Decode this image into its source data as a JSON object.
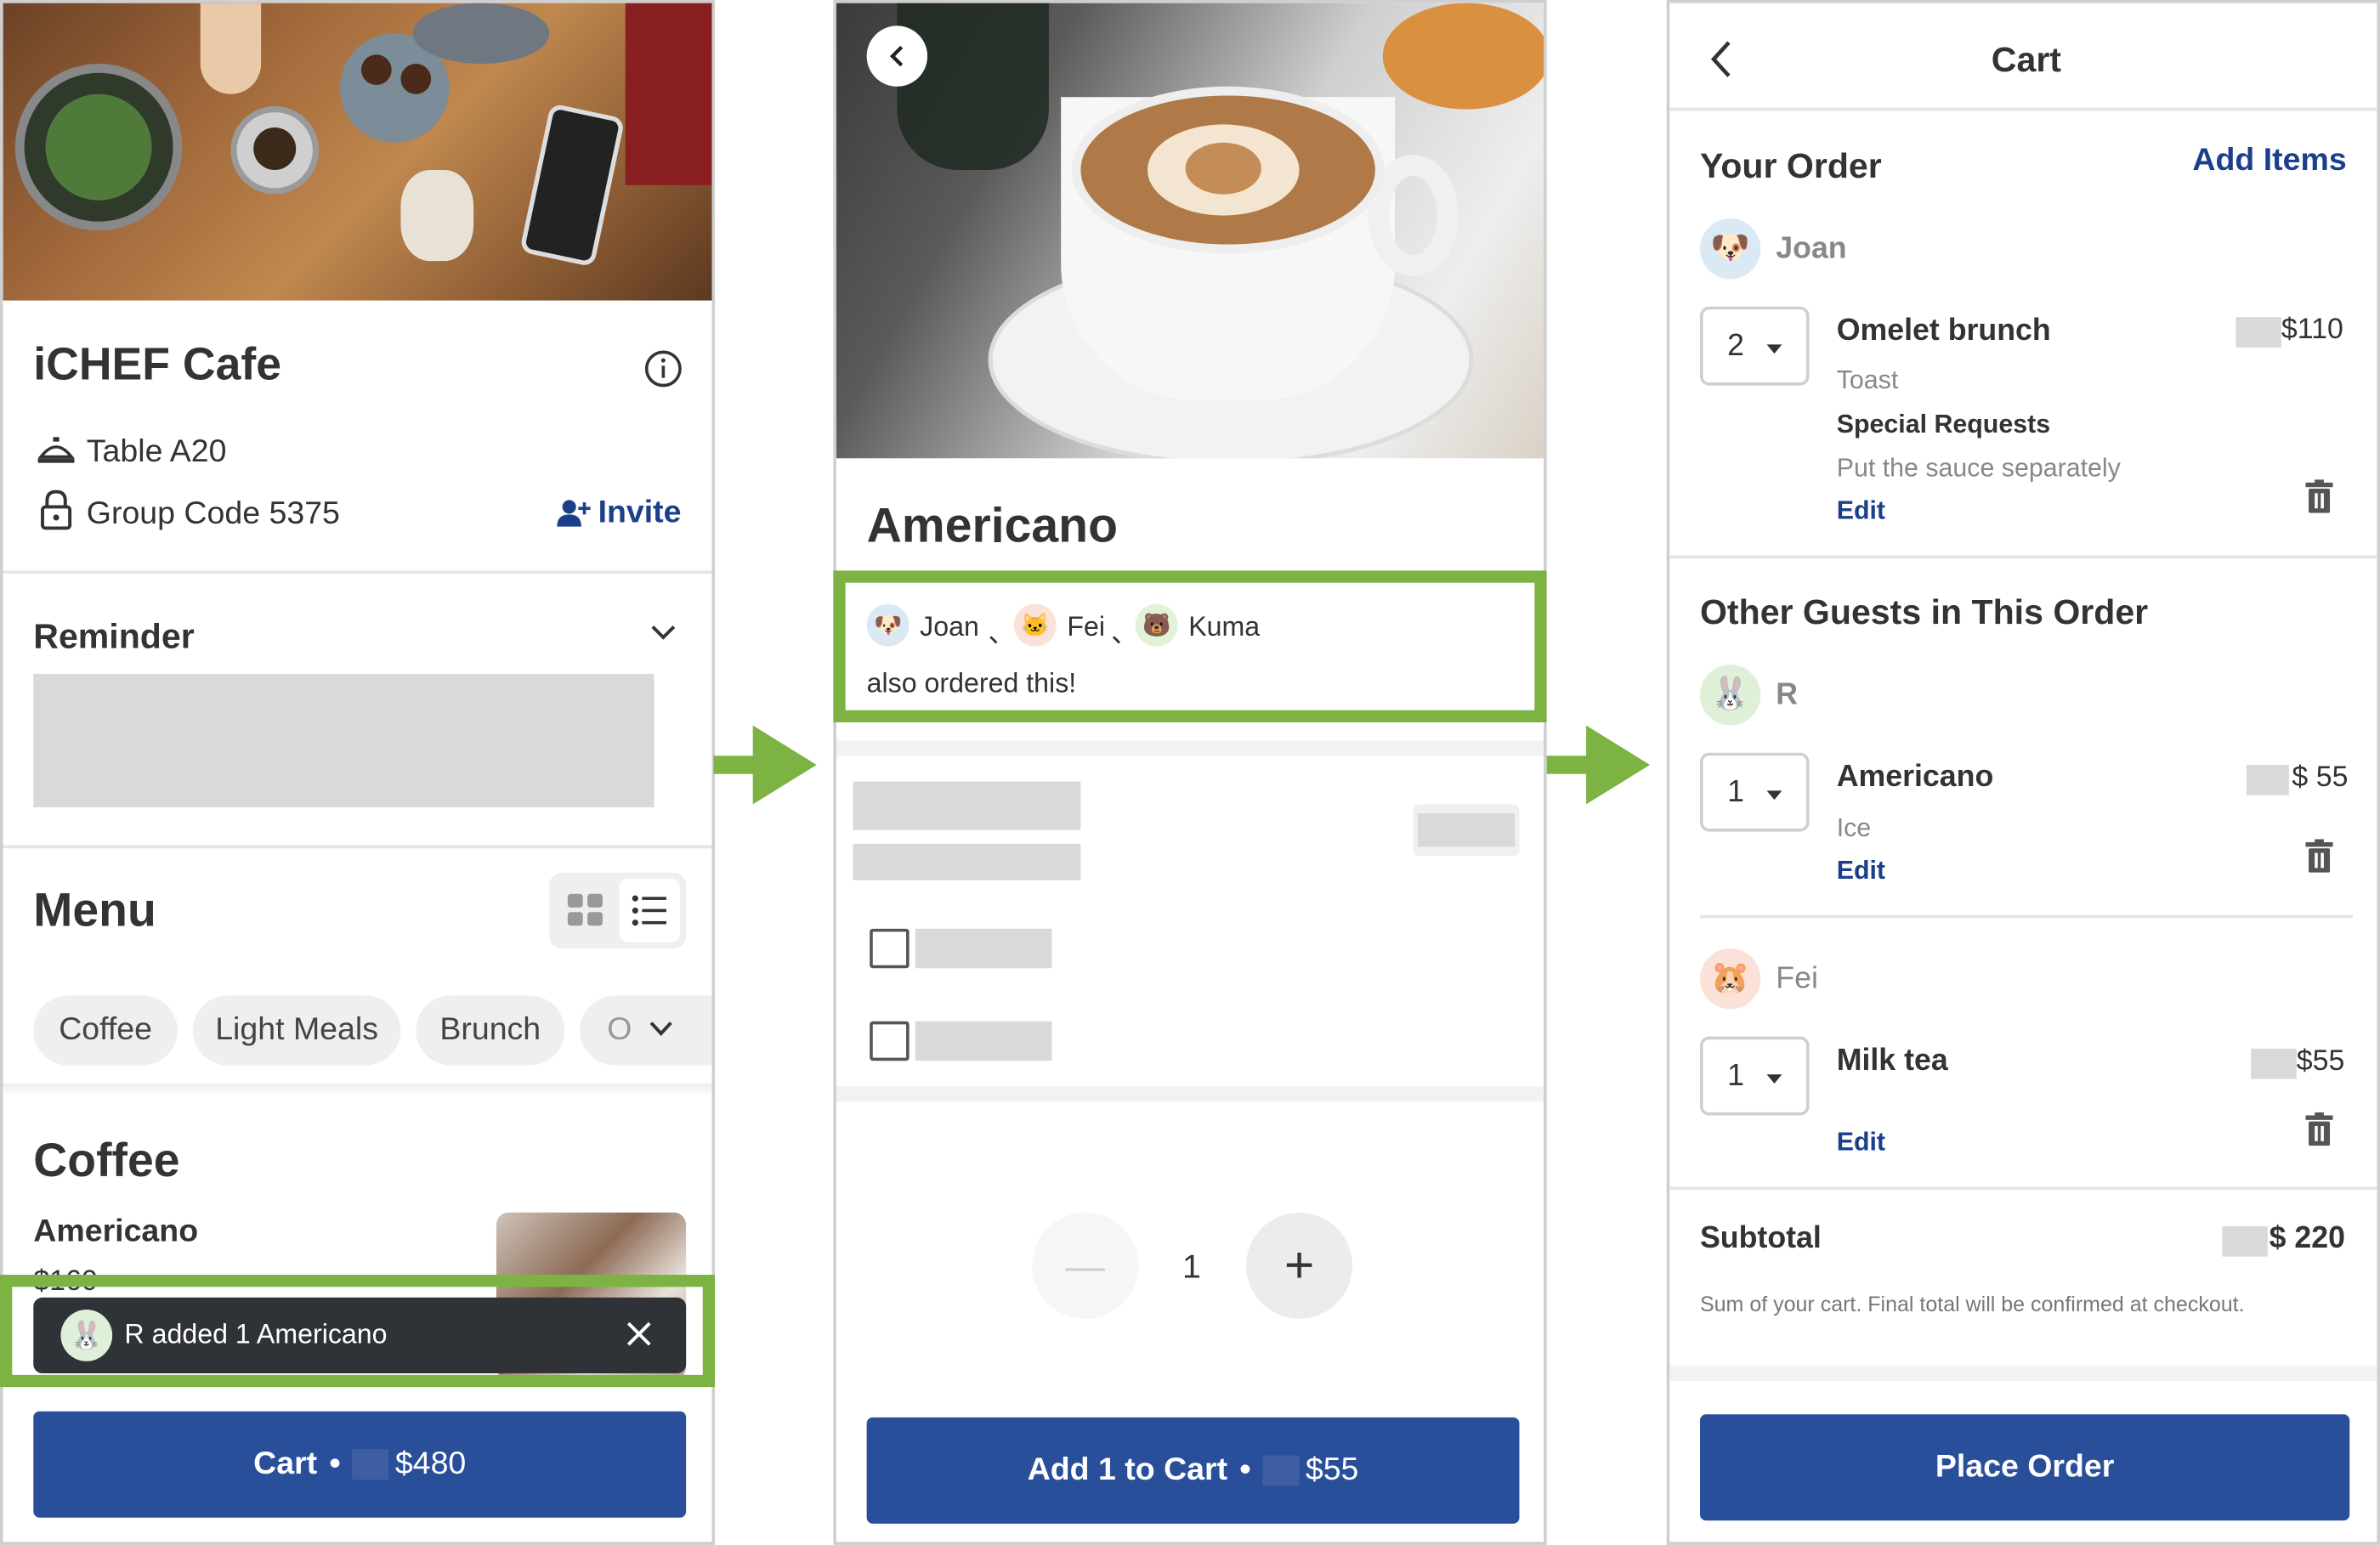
{
  "screen1": {
    "cafe_name": "iCHEF Cafe",
    "table_label": "Table A20",
    "group_code_label": "Group Code 5375",
    "invite_label": "Invite",
    "reminder_title": "Reminder",
    "menu_title": "Menu",
    "categories": [
      "Coffee",
      "Light Meals",
      "Brunch",
      "O"
    ],
    "section_title": "Coffee",
    "item_name": "Americano",
    "item_price": "$160",
    "toast_text": "R added 1 Americano",
    "cart_label": "Cart",
    "cart_dot": "•",
    "cart_total": "$480"
  },
  "screen2": {
    "product_name": "Americano",
    "guests": [
      "Joan",
      "Fei",
      "Kuma"
    ],
    "guest_sep": "、",
    "also_ordered": "also ordered this!",
    "quantity": "1",
    "minus_symbol": "—",
    "plus_symbol": "+",
    "add_label": "Add 1 to Cart",
    "add_dot": "•",
    "add_price": "$55"
  },
  "screen3": {
    "title": "Cart",
    "your_order_title": "Your Order",
    "add_items_label": "Add Items",
    "me": {
      "name": "Joan",
      "qty": "2",
      "item": "Omelet brunch",
      "option": "Toast",
      "special_title": "Special Requests",
      "special_text": "Put the sauce separately",
      "edit": "Edit",
      "price": "$110"
    },
    "others_title": "Other Guests in This Order",
    "guests": [
      {
        "name": "R",
        "qty": "1",
        "item": "Americano",
        "option": "Ice",
        "edit": "Edit",
        "price": "$ 55"
      },
      {
        "name": "Fei",
        "qty": "1",
        "item": "Milk tea",
        "edit": "Edit",
        "price": "$55"
      }
    ],
    "subtotal_label": "Subtotal",
    "subtotal_value": "$ 220",
    "subtotal_note": "Sum of your cart. Final total will be confirmed at checkout.",
    "place_order_label": "Place Order"
  },
  "colors": {
    "brand_blue": "#2a4f9a",
    "link_blue": "#1c3f8c",
    "highlight_green": "#7cb342"
  }
}
